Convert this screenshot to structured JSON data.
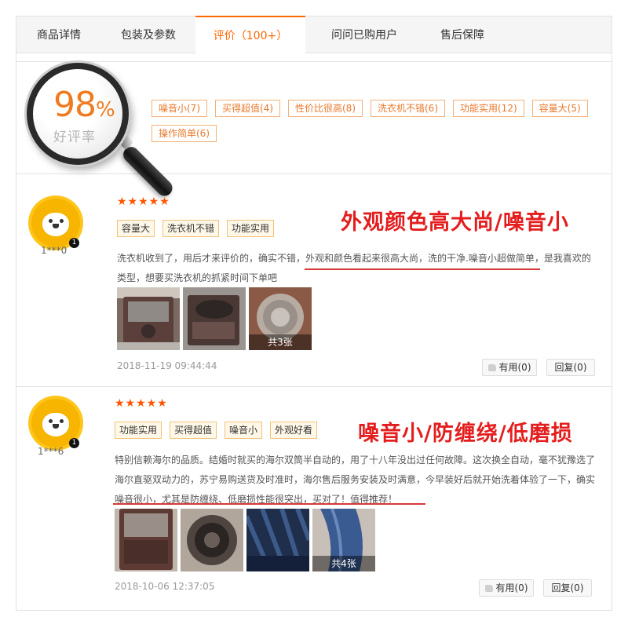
{
  "tabs": [
    {
      "label": "商品详情"
    },
    {
      "label": "包装及参数"
    },
    {
      "label": "评价（100+）",
      "active": true
    },
    {
      "label": "问问已购用户"
    },
    {
      "label": "售后保障"
    }
  ],
  "summary": {
    "rate_value": "98",
    "rate_unit": "%",
    "rate_label": "好评率",
    "tags": [
      "噪音小(7)",
      "买得超值(4)",
      "性价比很高(8)",
      "洗衣机不错(6)",
      "功能实用(12)",
      "容量大(5)",
      "操作简单(6)"
    ]
  },
  "reviews": [
    {
      "username": "1***0",
      "avatar_badge": "1",
      "stars": "★★★★★",
      "tags": [
        "容量大",
        "洗衣机不错",
        "功能实用"
      ],
      "headline": "外观颜色高大尚/噪音小",
      "text": "洗衣机收到了，用后才来评价的，确实不错，外观和颜色看起来很高大尚，洗的干净.噪音小超做简单，是我喜欢的类型，想要买洗衣机的抓紧时间下单吧",
      "photo_count_label": "共3张",
      "date": "2018-11-19 09:44:44",
      "useful_label": "有用(0)",
      "reply_label": "回复(0)"
    },
    {
      "username": "1***6",
      "avatar_badge": "1",
      "stars": "★★★★★",
      "tags": [
        "功能实用",
        "买得超值",
        "噪音小",
        "外观好看"
      ],
      "headline": "噪音小/防缠绕/低磨损",
      "text": "特别信赖海尔的品质。结婚时就买的海尔双筒半自动的，用了十八年没出过任何故障。这次换全自动，毫不犹豫选了海尔直驱双动力的，苏宁易购送货及时准时，海尔售后服务安装及时满意，今早装好后就开始洗着体验了一下，确实噪音很小，尤其是防缠绕、低磨损性能很突出，买对了！值得推荐！",
      "photo_count_label": "共4张",
      "date": "2018-10-06 12:37:05",
      "useful_label": "有用(0)",
      "reply_label": "回复(0)"
    }
  ],
  "colors": {
    "accent": "#ff6600",
    "headline": "#e41e1e",
    "tag_border": "#f2b27a",
    "avatar": "#f7b500"
  },
  "icons": [
    "magnifier-icon",
    "star-icon",
    "thumbs-up-icon",
    "lion-avatar-icon"
  ]
}
